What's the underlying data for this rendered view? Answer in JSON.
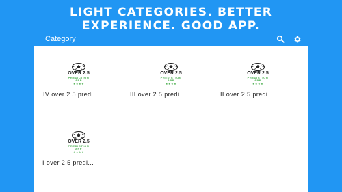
{
  "banner": {
    "line1": "LIGHT CATEGORIES. BETTER",
    "line2": "EXPERIENCE. GOOD APP."
  },
  "appbar": {
    "title": "Category",
    "search_icon": "search-icon",
    "settings_icon": "gear-icon"
  },
  "items": [
    {
      "thumb_title": "OVER 2.5",
      "thumb_sub1": "PREDICTION",
      "thumb_sub2": "APP",
      "thumb_stars": "★★★★",
      "caption": "IV over 2.5 predi..."
    },
    {
      "thumb_title": "OVER 2.5",
      "thumb_sub1": "PREDICTION",
      "thumb_sub2": "APP",
      "thumb_stars": "★★★★",
      "caption": "III over 2.5 predi..."
    },
    {
      "thumb_title": "OVER 2.5",
      "thumb_sub1": "PREDICTION",
      "thumb_sub2": "APP",
      "thumb_stars": "★★★★",
      "caption": "II over 2.5 predi..."
    },
    {
      "thumb_title": "OVER 2.5",
      "thumb_sub1": "PREDICTION",
      "thumb_sub2": "APP",
      "thumb_stars": "★★★★",
      "caption": "I over 2.5 predi..."
    }
  ],
  "colors": {
    "background": "#2196f3",
    "accent_green": "#4caf50"
  }
}
